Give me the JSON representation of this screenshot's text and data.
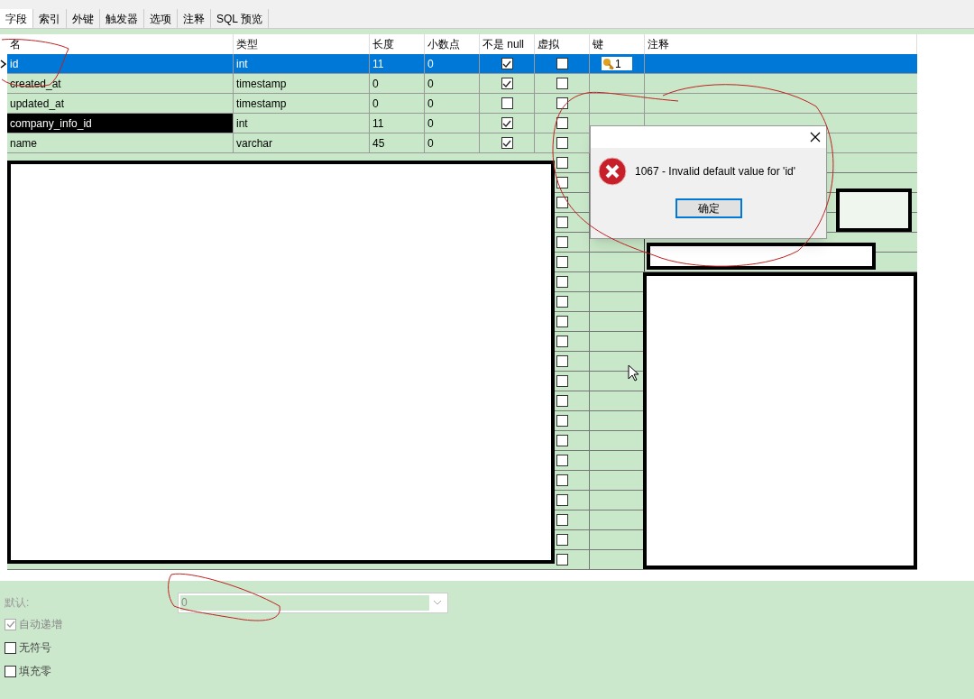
{
  "tabs": [
    {
      "label": "字段",
      "selected": true
    },
    {
      "label": "索引",
      "selected": false
    },
    {
      "label": "外键",
      "selected": false
    },
    {
      "label": "触发器",
      "selected": false
    },
    {
      "label": "选项",
      "selected": false
    },
    {
      "label": "注释",
      "selected": false
    },
    {
      "label": "SQL 预览",
      "selected": false
    }
  ],
  "columns": [
    "名",
    "类型",
    "长度",
    "小数点",
    "不是 null",
    "虚拟",
    "键",
    "注释"
  ],
  "rows": [
    {
      "name": "id",
      "type": "int",
      "length": "11",
      "decimals": "0",
      "not_null": true,
      "virtual": false,
      "key": "1",
      "selected": true,
      "redacted": false
    },
    {
      "name": "created_at",
      "type": "timestamp",
      "length": "0",
      "decimals": "0",
      "not_null": true,
      "virtual": false,
      "selected": false,
      "redacted": false
    },
    {
      "name": "updated_at",
      "type": "timestamp",
      "length": "0",
      "decimals": "0",
      "not_null": false,
      "virtual": false,
      "selected": false,
      "redacted": false
    },
    {
      "name": "company_info_id",
      "type": "int",
      "length": "11",
      "decimals": "0",
      "not_null": true,
      "virtual": false,
      "selected": false,
      "redacted": true
    },
    {
      "name": "name",
      "type": "varchar",
      "length": "45",
      "decimals": "0",
      "not_null": true,
      "virtual": false,
      "selected": false,
      "redacted": false
    }
  ],
  "hidden_rows": [
    {
      "virtual": false
    },
    {
      "virtual": false
    },
    {
      "virtual": false
    },
    {
      "virtual": false
    },
    {
      "virtual": false
    },
    {
      "virtual": false
    },
    {
      "virtual": false
    },
    {
      "virtual": false
    },
    {
      "virtual": false
    },
    {
      "virtual": false
    },
    {
      "virtual": false
    },
    {
      "virtual": false
    },
    {
      "virtual": false
    },
    {
      "virtual": false
    },
    {
      "virtual": false
    },
    {
      "virtual": false
    },
    {
      "virtual": false
    },
    {
      "virtual": false
    },
    {
      "virtual": false
    },
    {
      "virtual": false
    },
    {
      "virtual": false
    }
  ],
  "dialog": {
    "message": "1067 - Invalid default value for 'id'",
    "button": "确定"
  },
  "properties": {
    "default_label": "默认:",
    "default_value": "0",
    "options": [
      {
        "label": "自动递增",
        "checked": true,
        "disabled": true
      },
      {
        "label": "无符号",
        "checked": false,
        "disabled": false
      },
      {
        "label": "填充零",
        "checked": false,
        "disabled": false
      }
    ]
  }
}
